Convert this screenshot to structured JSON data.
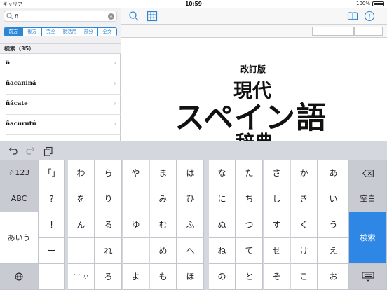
{
  "status": {
    "carrier": "キャリア",
    "time": "10:59",
    "battery": "100%"
  },
  "search": {
    "value": "ñ"
  },
  "segments": [
    "前方",
    "後方",
    "完全",
    "動活用",
    "部分",
    "全文"
  ],
  "results_label": "検索（35）",
  "results": [
    "ñ",
    "ñacaniná",
    "ñácate",
    "ñacurutú"
  ],
  "book": {
    "edition": "改訂版",
    "line1": "現代",
    "line2": "スペイン語",
    "line3": "辞典"
  },
  "keyboard": {
    "left_keys": [
      "☆123",
      "ABC",
      "あいう"
    ],
    "right_keys": [
      "空白",
      "検索"
    ],
    "rows": [
      [
        "「」",
        "わ",
        "ら",
        "や",
        "ま",
        "は",
        "な",
        "た",
        "さ",
        "か",
        "あ"
      ],
      [
        "?",
        "を",
        "り",
        "",
        "み",
        "ひ",
        "に",
        "ち",
        "し",
        "き",
        "い"
      ],
      [
        "!",
        "ん",
        "る",
        "ゆ",
        "む",
        "ふ",
        "ぬ",
        "つ",
        "す",
        "く",
        "う"
      ],
      [
        "ー",
        "",
        "れ",
        "",
        "め",
        "へ",
        "ね",
        "て",
        "せ",
        "け",
        "え"
      ],
      [
        "",
        "",
        "ろ",
        "よ",
        "も",
        "ほ",
        "の",
        "と",
        "そ",
        "こ",
        "お"
      ]
    ],
    "dakuten_label": "゛゜小"
  },
  "accent_color": "#2a87d8"
}
